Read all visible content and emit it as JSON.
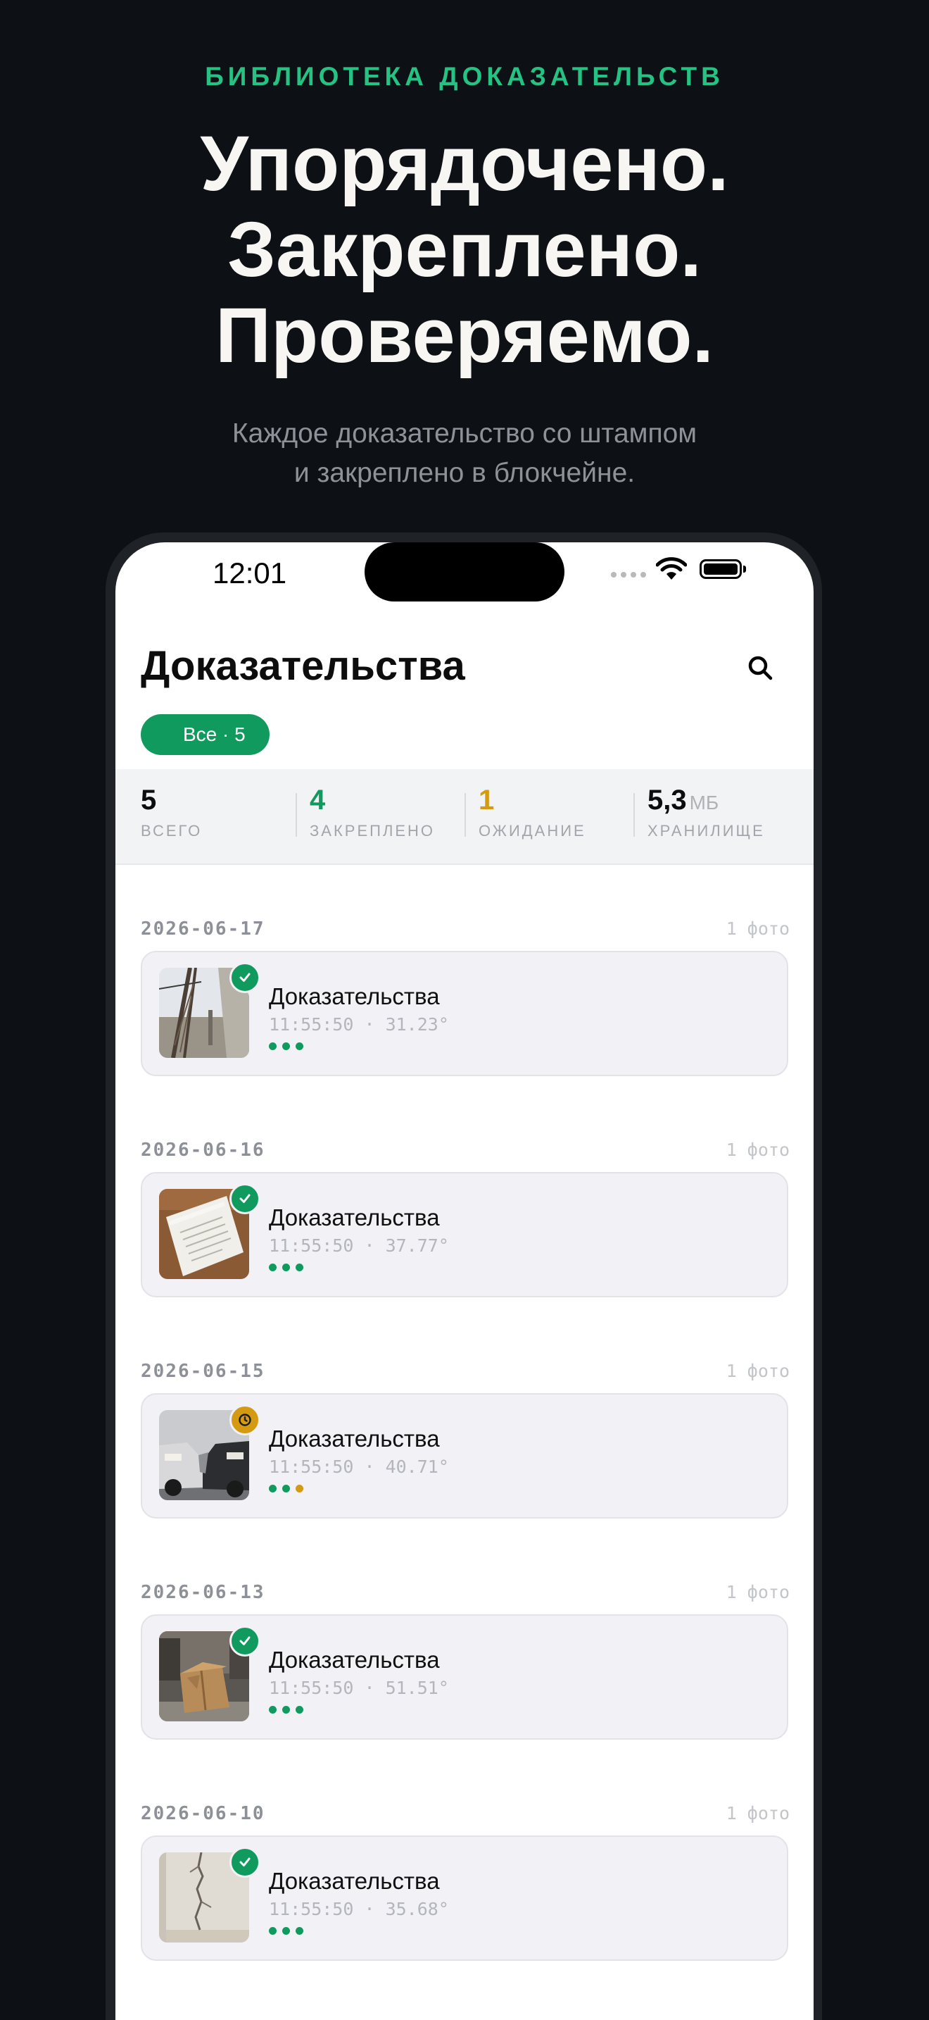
{
  "hero": {
    "kicker": "БИБЛИОТЕКА ДОКАЗАТЕЛЬСТВ",
    "headline_lines": [
      "Упорядочено.",
      "Закреплено.",
      "Проверяемо."
    ],
    "subtitle_lines": [
      "Каждое доказательство со штампом",
      "и закреплено в блокчейне."
    ]
  },
  "status_bar": {
    "time": "12:01"
  },
  "screen": {
    "title": "Доказательства",
    "filter_chip": "Все · 5",
    "stats": [
      {
        "value": "5",
        "unit": "",
        "label": "ВСЕГО",
        "color": "#0d0d0d"
      },
      {
        "value": "4",
        "unit": "",
        "label": "ЗАКРЕПЛЕНО",
        "color": "#109a5e"
      },
      {
        "value": "1",
        "unit": "",
        "label": "ОЖИДАНИЕ",
        "color": "#d39a12"
      },
      {
        "value": "5,3",
        "unit": "МБ",
        "label": "ХРАНИЛИЩЕ",
        "color": "#0d0d0d"
      }
    ],
    "groups": [
      {
        "date": "2026-06-17",
        "count": "1 фото",
        "item": {
          "title": "Доказательства",
          "meta": "11:55:50 · 31.23°",
          "status": "anchored",
          "thumb": "crane"
        }
      },
      {
        "date": "2026-06-16",
        "count": "1 фото",
        "item": {
          "title": "Доказательства",
          "meta": "11:55:50 · 37.77°",
          "status": "anchored",
          "thumb": "document"
        }
      },
      {
        "date": "2026-06-15",
        "count": "1 фото",
        "item": {
          "title": "Доказательства",
          "meta": "11:55:50 · 40.71°",
          "status": "pending",
          "thumb": "car-crash"
        }
      },
      {
        "date": "2026-06-13",
        "count": "1 фото",
        "item": {
          "title": "Доказательства",
          "meta": "11:55:50 · 51.51°",
          "status": "anchored",
          "thumb": "damaged-box"
        }
      },
      {
        "date": "2026-06-10",
        "count": "1 фото",
        "item": {
          "title": "Доказательства",
          "meta": "11:55:50 · 35.68°",
          "status": "anchored",
          "thumb": "wall-crack"
        }
      }
    ]
  },
  "colors": {
    "accent_green": "#109a5e",
    "kicker_green": "#25c283",
    "pending_amber": "#d39a12",
    "background": "#0d1014"
  },
  "icons": {
    "search": "search-icon",
    "wifi": "wifi-icon",
    "battery": "battery-icon",
    "anchored_badge": "checkmark-icon",
    "pending_badge": "clock-icon"
  }
}
